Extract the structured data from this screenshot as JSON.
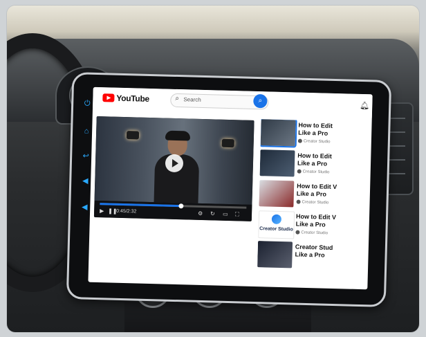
{
  "app": {
    "logo_text": "YouTube"
  },
  "search": {
    "placeholder": "Search"
  },
  "player": {
    "time": "0:45/2:32",
    "progress": 0.55
  },
  "recommendations": [
    {
      "title": "How to Edit\nLike a Pro",
      "channel": "Creator Studio"
    },
    {
      "title": "How to Edit\nLike a Pro",
      "channel": "Creator Studio"
    },
    {
      "title": "How to Edit V\nLike a Pro",
      "channel": "Creator Studio"
    },
    {
      "title": "How to Edit V\nLike a Pro",
      "channel": "Creator Studio"
    },
    {
      "title": "Creator Stud\nLike a Pro",
      "channel": ""
    }
  ],
  "creator_thumb_text": "Creator Studio",
  "colors": {
    "youtube_red": "#ff0000",
    "accent_blue": "#1a73e8",
    "side_icon_blue": "#29a9ff"
  },
  "icons": {
    "search": "search-icon",
    "bell": "bell-icon",
    "play": "play-icon",
    "pause": "pause-icon"
  }
}
